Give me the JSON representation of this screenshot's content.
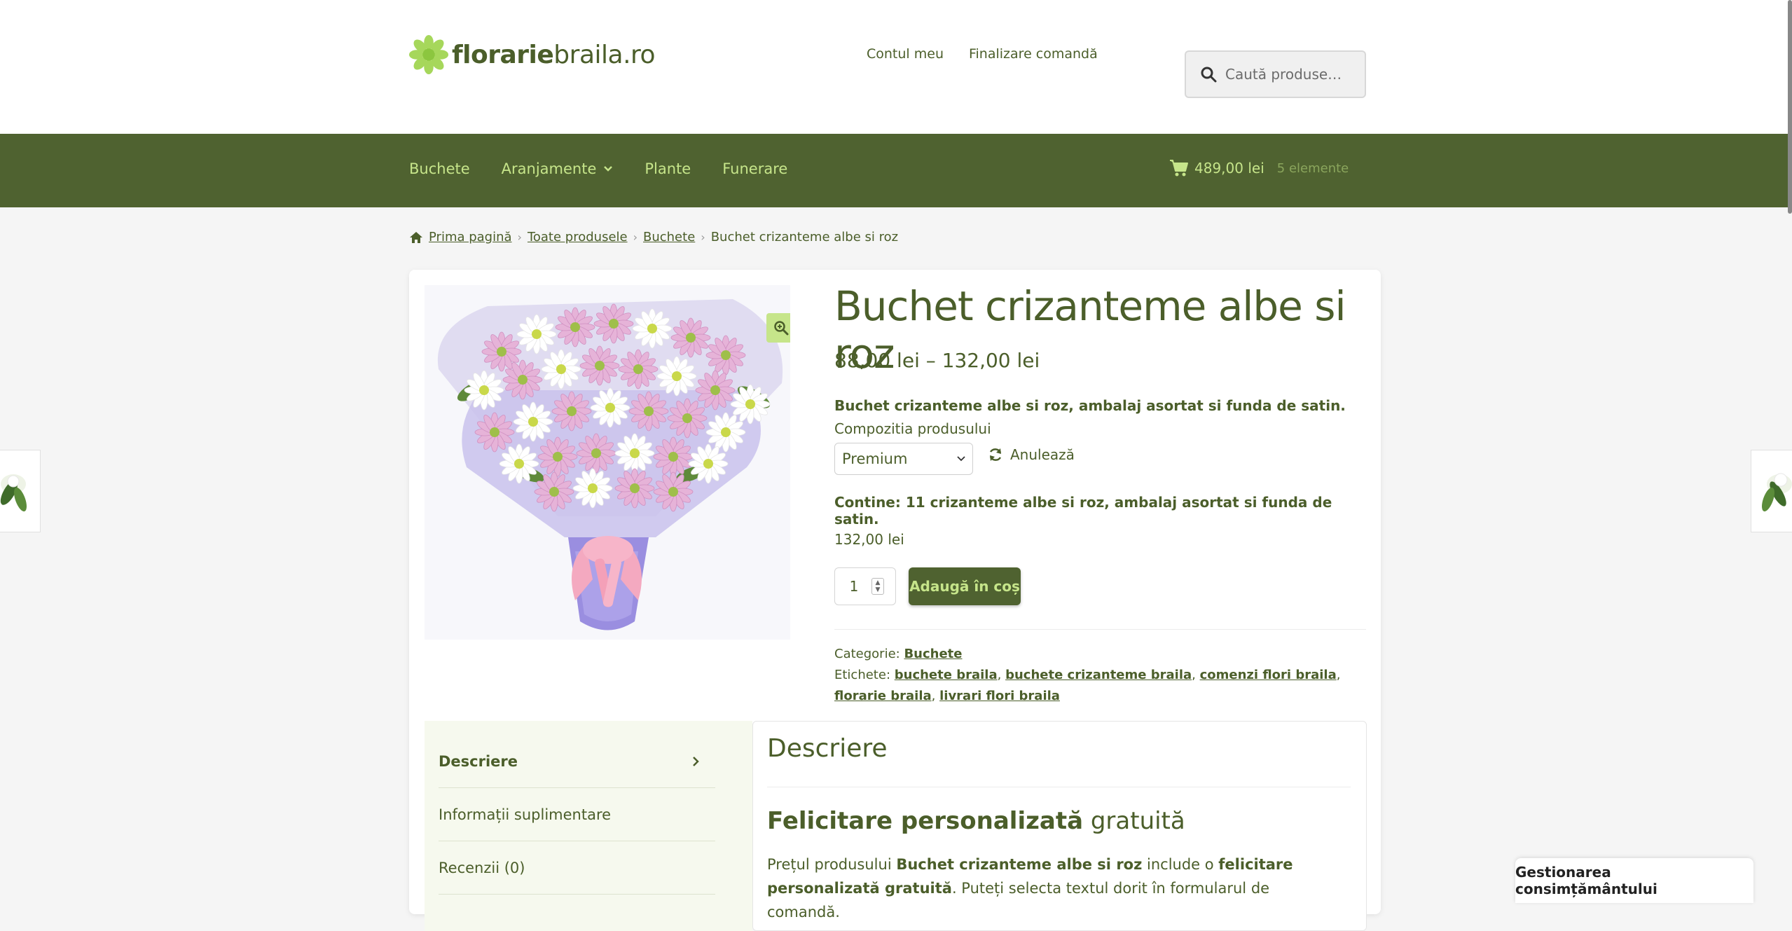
{
  "header": {
    "logo_bold": "florarie",
    "logo_regular": "braila.ro",
    "links": [
      "Contul meu",
      "Finalizare comandă"
    ],
    "search_placeholder": "Caută produse…"
  },
  "nav": {
    "items": [
      "Buchete",
      "Aranjamente",
      "Plante",
      "Funerare"
    ],
    "cart_total": "489,00 lei",
    "cart_count": "5 elemente"
  },
  "breadcrumb": {
    "items": [
      "Prima pagină",
      "Toate produsele",
      "Buchete"
    ],
    "current": "Buchet crizanteme albe si roz"
  },
  "product": {
    "title": "Buchet crizanteme albe si roz",
    "price_range": "88,00 lei – 132,00 lei",
    "short_desc": "Buchet crizanteme albe si roz, ambalaj asortat si funda de satin.",
    "composition_label": "Compozitia produsului",
    "composition_selected": "Premium",
    "reset_label": "Anulează",
    "contains": "Contine: 11 crizanteme albe si roz, ambalaj asortat si funda de satin.",
    "variation_price": "132,00 lei",
    "quantity": "1",
    "add_to_cart": "Adaugă în coș",
    "category_label": "Categorie:",
    "category": "Buchete",
    "tags_label": "Etichete:",
    "tags": [
      "buchete braila",
      "buchete crizanteme braila",
      "comenzi flori braila",
      "florarie braila",
      "livrari flori braila"
    ]
  },
  "tabs": {
    "items": [
      "Descriere",
      "Informații suplimentare",
      "Recenzii (0)"
    ],
    "active": "Descriere"
  },
  "description": {
    "heading": "Descriere",
    "sub_bold": "Felicitare personalizată",
    "sub_regular": " gratuită",
    "text_1": "Prețul produsului ",
    "text_product": "Buchet crizanteme albe si roz",
    "text_2": " include o ",
    "text_card": "felicitare personalizată gratuită",
    "text_3": ". Puteți selecta textul dorit în formularul de comandă."
  },
  "consent": {
    "label": "Gestionarea consimțământului"
  },
  "colors": {
    "brand_green": "#4f6230",
    "accent_lime": "#c6e58a",
    "text_green": "#4b5e2a"
  }
}
